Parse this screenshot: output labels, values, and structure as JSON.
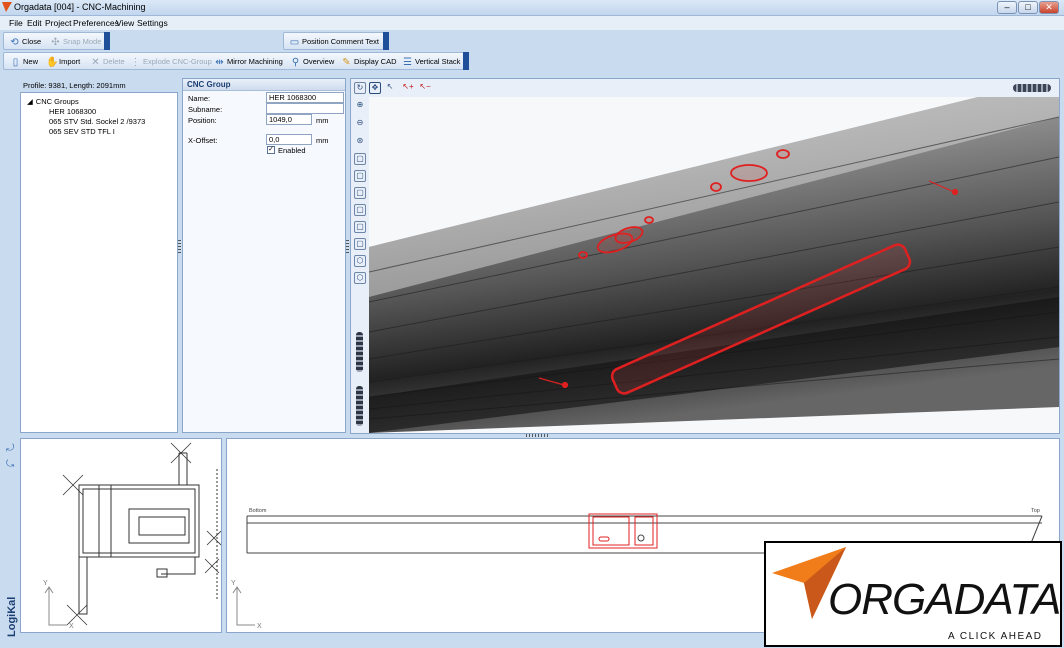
{
  "window": {
    "title": "Orgadata [004] - CNC-Machining"
  },
  "menu": [
    "File",
    "Edit",
    "Project",
    "Preferences",
    "View",
    "Settings"
  ],
  "toolbar1": {
    "close": "Close",
    "snap": "Snap Mode",
    "position_comment": "Position Comment Text"
  },
  "toolbar2": {
    "new": "New",
    "import": "Import",
    "delete": "Delete",
    "explode": "Explode CNC-Group",
    "mirror": "Mirror Machining",
    "overview": "Overview",
    "display_cad": "Display CAD",
    "vertical_stack": "Vertical Stack"
  },
  "profile": {
    "info": "Profile: 9381, Length: 2091mm"
  },
  "tree": {
    "root": "CNC Groups",
    "items": [
      "HER 1068300",
      "065 STV Std. Sockel 2 /9373",
      "065 SEV STD TFL I"
    ]
  },
  "cnc_group": {
    "header": "CNC Group",
    "name_label": "Name:",
    "name_value": "HER 1068300",
    "subname_label": "Subname:",
    "subname_value": "",
    "position_label": "Position:",
    "position_value": "1049,0",
    "position_unit": "mm",
    "xoffset_label": "X-Offset:",
    "xoffset_value": "0,0",
    "xoffset_unit": "mm",
    "enabled_label": "Enabled",
    "enabled": true
  },
  "drawing": {
    "left_label": "Bottom",
    "right_label": "Top",
    "axis_y": "Y",
    "axis_x": "X"
  },
  "brand": {
    "side": "LogiKal",
    "name": "ORGADATA",
    "tagline": "A CLICK AHEAD"
  },
  "colors": {
    "accent": "#1f4f98",
    "machining": "#e02020",
    "logo_orange": "#f07d1a"
  }
}
